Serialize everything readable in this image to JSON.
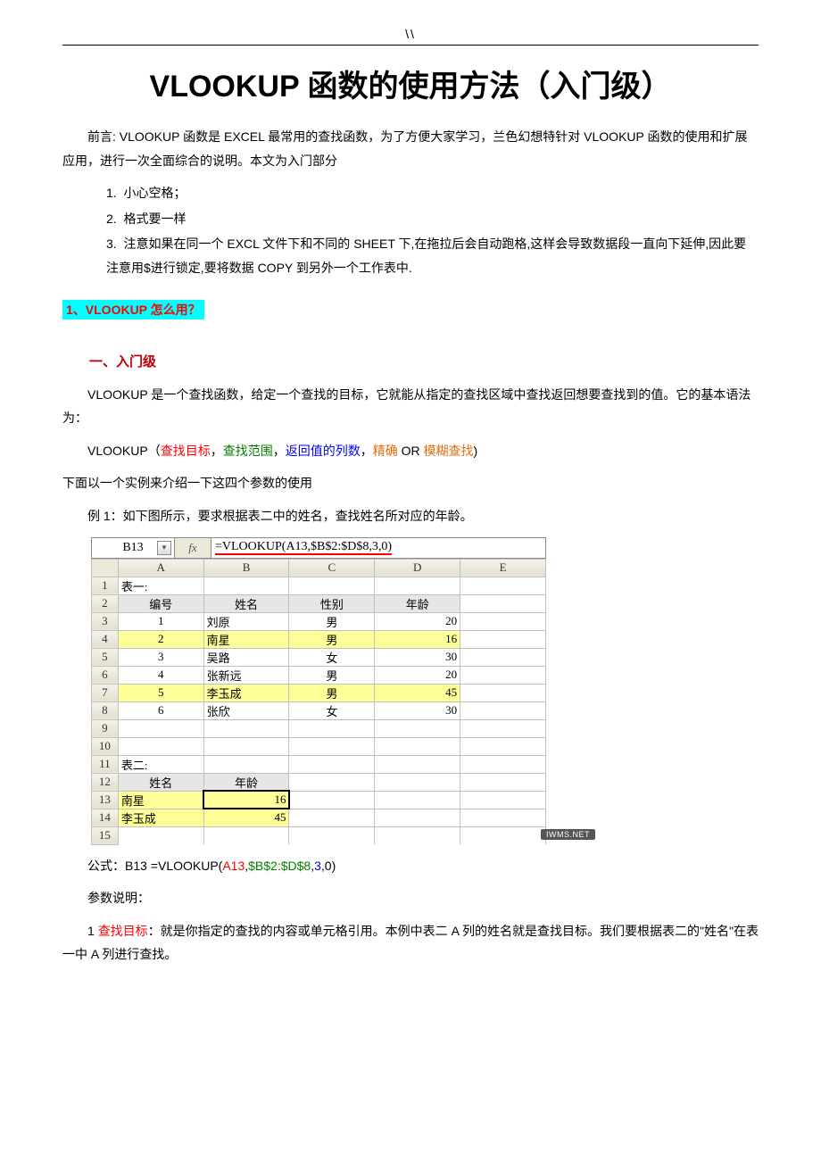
{
  "header_mark": "\\\\",
  "title": "VLOOKUP 函数的使用方法（入门级）",
  "preface": "前言: VLOOKUP 函数是 EXCEL 最常用的查找函数，为了方便大家学习，兰色幻想特针对 VLOOKUP 函数的使用和扩展应用，进行一次全面综合的说明。本文为入门部分",
  "notes": [
    "小心空格；",
    "格式要一样",
    "注意如果在同一个 EXCL 文件下和不同的 SHEET 下,在拖拉后会自动跑格,这样会导致数据段一直向下延伸,因此要注意用$进行锁定,要将数据 COPY 到另外一个工作表中."
  ],
  "q1_label": "1、VLOOKUP 怎么用？",
  "section1_title": "一、入门级",
  "intro_para": "VLOOKUP 是一个查找函数，给定一个查找的目标，它就能从指定的查找区域中查找返回想要查找到的值。它的基本语法为：",
  "syntax": {
    "prefix": "VLOOKUP（",
    "a1": "查找目标",
    "c1": "，",
    "a2": "查找范围",
    "c2": "，",
    "a3": "返回值的列数",
    "c3": "，",
    "a4_a": "精确",
    "a4_mid": " OR ",
    "a4_b": "模糊查找",
    "suffix": ")"
  },
  "example_lead": "下面以一个实例来介绍一下这四个参数的使用",
  "example1": "例 1：如下图所示，要求根据表二中的姓名，查找姓名所对应的年龄。",
  "excel": {
    "name_box": "B13",
    "fx": "fx",
    "formula": "=VLOOKUP(A13,$B$2:$D$8,3,0)",
    "cols": [
      "A",
      "B",
      "C",
      "D",
      "E"
    ],
    "t1_label": "表一:",
    "t1_headers": [
      "编号",
      "姓名",
      "性别",
      "年龄"
    ],
    "t1_rows": [
      {
        "n": "1",
        "name": "刘原",
        "sex": "男",
        "age": "20"
      },
      {
        "n": "2",
        "name": "南星",
        "sex": "男",
        "age": "16",
        "hl": true
      },
      {
        "n": "3",
        "name": "吴路",
        "sex": "女",
        "age": "30"
      },
      {
        "n": "4",
        "name": "张新远",
        "sex": "男",
        "age": "20"
      },
      {
        "n": "5",
        "name": "李玉成",
        "sex": "男",
        "age": "45",
        "hl": true
      },
      {
        "n": "6",
        "name": "张欣",
        "sex": "女",
        "age": "30"
      }
    ],
    "t2_label": "表二:",
    "t2_headers": [
      "姓名",
      "年龄"
    ],
    "t2_rows": [
      {
        "name": "南星",
        "age": "16",
        "sel": true
      },
      {
        "name": "李玉成",
        "age": "45"
      }
    ],
    "watermark": "IWMS.NET"
  },
  "formula_line": {
    "prefix": "公式：B13 =VLOOKUP(",
    "p1": "A13",
    "c1": ",",
    "p2": "$B$2:$D$8",
    "c2": ",",
    "p3": "3",
    "c3": ",0)"
  },
  "param_label": "参数说明：",
  "param1": {
    "num": "1 ",
    "name": "查找目标",
    "rest": "：就是你指定的查找的内容或单元格引用。本例中表二 A 列的姓名就是查找目标。我们要根据表二的\"姓名\"在表一中 A 列进行查找。"
  }
}
